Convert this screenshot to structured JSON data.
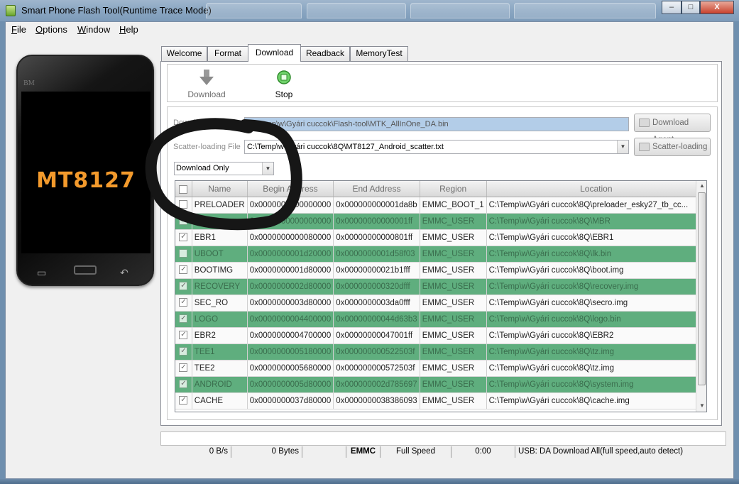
{
  "window": {
    "title": "Smart Phone Flash Tool(Runtime Trace Mode)",
    "minimize_glyph": "–",
    "maximize_glyph": "□",
    "close_glyph": "X"
  },
  "menubar": {
    "items": [
      {
        "label": "File"
      },
      {
        "label": "Options"
      },
      {
        "label": "Window"
      },
      {
        "label": "Help"
      }
    ]
  },
  "phone": {
    "brand": "BM",
    "model": "MT8127"
  },
  "tabs": [
    {
      "label": "Welcome"
    },
    {
      "label": "Format"
    },
    {
      "label": "Download"
    },
    {
      "label": "Readback"
    },
    {
      "label": "MemoryTest"
    }
  ],
  "active_tab": "Download",
  "toolbar": {
    "download_label": "Download",
    "stop_label": "Stop"
  },
  "download_agent": {
    "label": "Download-Agent",
    "path": "C:\\Temp\\w\\Gyári cuccok\\Flash-tool\\MTK_AllInOne_DA.bin",
    "button": "Download Agent"
  },
  "scatter": {
    "label": "Scatter-loading File",
    "path": "C:\\Temp\\w\\Gyári cuccok\\8Q\\MT8127_Android_scatter.txt",
    "button": "Scatter-loading"
  },
  "mode_select": {
    "value": "Download Only"
  },
  "table": {
    "columns": [
      "Name",
      "Begin Address",
      "End Address",
      "Region",
      "Location"
    ],
    "rows": [
      {
        "checked": false,
        "name": "PRELOADER",
        "begin": "0x0000000000000000",
        "end": "0x000000000001da8b",
        "region": "EMMC_BOOT_1",
        "location": "C:\\Temp\\w\\Gyári cuccok\\8Q\\preloader_esky27_tb_cc..."
      },
      {
        "checked": true,
        "name": "MBR",
        "begin": "0x0000000000000000",
        "end": "0x00000000000001ff",
        "region": "EMMC_USER",
        "location": "C:\\Temp\\w\\Gyári cuccok\\8Q\\MBR"
      },
      {
        "checked": true,
        "name": "EBR1",
        "begin": "0x0000000000080000",
        "end": "0x00000000000801ff",
        "region": "EMMC_USER",
        "location": "C:\\Temp\\w\\Gyári cuccok\\8Q\\EBR1"
      },
      {
        "checked": false,
        "name": "UBOOT",
        "begin": "0x0000000001d20000",
        "end": "0x0000000001d58f03",
        "region": "EMMC_USER",
        "location": "C:\\Temp\\w\\Gyári cuccok\\8Q\\lk.bin"
      },
      {
        "checked": true,
        "name": "BOOTIMG",
        "begin": "0x0000000001d80000",
        "end": "0x00000000021b1fff",
        "region": "EMMC_USER",
        "location": "C:\\Temp\\w\\Gyári cuccok\\8Q\\boot.img"
      },
      {
        "checked": true,
        "name": "RECOVERY",
        "begin": "0x0000000002d80000",
        "end": "0x000000000320dfff",
        "region": "EMMC_USER",
        "location": "C:\\Temp\\w\\Gyári cuccok\\8Q\\recovery.img"
      },
      {
        "checked": true,
        "name": "SEC_RO",
        "begin": "0x0000000003d80000",
        "end": "0x0000000003da0fff",
        "region": "EMMC_USER",
        "location": "C:\\Temp\\w\\Gyári cuccok\\8Q\\secro.img"
      },
      {
        "checked": true,
        "name": "LOGO",
        "begin": "0x0000000004400000",
        "end": "0x00000000044d63b3",
        "region": "EMMC_USER",
        "location": "C:\\Temp\\w\\Gyári cuccok\\8Q\\logo.bin"
      },
      {
        "checked": true,
        "name": "EBR2",
        "begin": "0x0000000004700000",
        "end": "0x00000000047001ff",
        "region": "EMMC_USER",
        "location": "C:\\Temp\\w\\Gyári cuccok\\8Q\\EBR2"
      },
      {
        "checked": true,
        "name": "TEE1",
        "begin": "0x0000000005180000",
        "end": "0x000000000522503f",
        "region": "EMMC_USER",
        "location": "C:\\Temp\\w\\Gyári cuccok\\8Q\\tz.img"
      },
      {
        "checked": true,
        "name": "TEE2",
        "begin": "0x0000000005680000",
        "end": "0x000000000572503f",
        "region": "EMMC_USER",
        "location": "C:\\Temp\\w\\Gyári cuccok\\8Q\\tz.img"
      },
      {
        "checked": true,
        "name": "ANDROID",
        "begin": "0x0000000005d80000",
        "end": "0x000000002d785697",
        "region": "EMMC_USER",
        "location": "C:\\Temp\\w\\Gyári cuccok\\8Q\\system.img"
      },
      {
        "checked": true,
        "name": "CACHE",
        "begin": "0x0000000037d80000",
        "end": "0x0000000038386093",
        "region": "EMMC_USER",
        "location": "C:\\Temp\\w\\Gyári cuccok\\8Q\\cache.img"
      }
    ]
  },
  "statusbar": {
    "speed": "0 B/s",
    "bytes": "0 Bytes",
    "storage": "EMMC",
    "usb_speed": "Full Speed",
    "time": "0:00",
    "message": "USB: DA Download All(full speed,auto detect)"
  },
  "colors": {
    "highlight_row": "#5fae7e",
    "da_field_bg": "#b3cde8",
    "phone_model_text": "#f39a2c",
    "titlebar": "#8aa6c2"
  },
  "icons": {
    "download": "down-arrow-icon",
    "stop": "green-stop-circle-icon",
    "folder": "folder-icon"
  }
}
